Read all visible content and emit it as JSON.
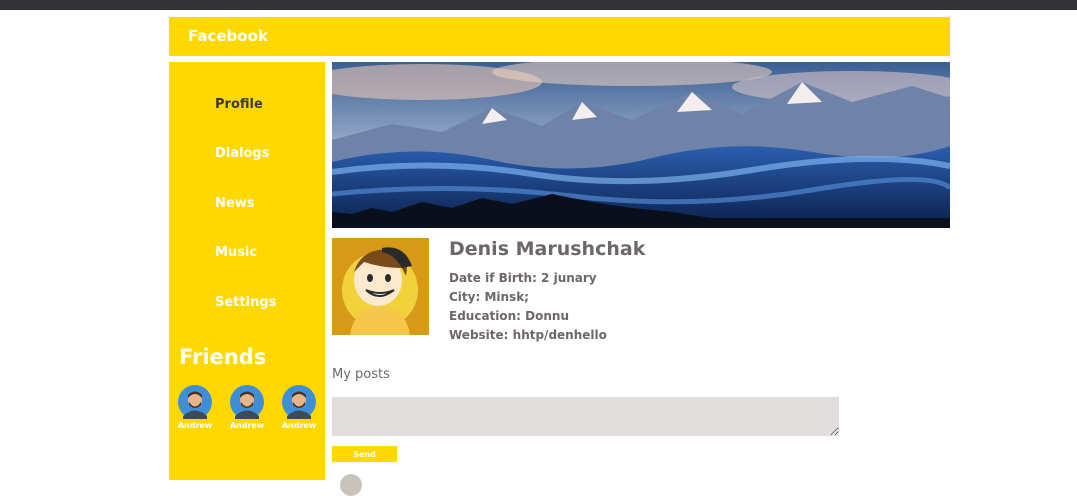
{
  "header": {
    "brand": "Facebook"
  },
  "sidebar": {
    "items": [
      {
        "label": "Profile",
        "active": true
      },
      {
        "label": "Dialogs",
        "active": false
      },
      {
        "label": "News",
        "active": false
      },
      {
        "label": "Music",
        "active": false
      },
      {
        "label": "Settings",
        "active": false
      }
    ],
    "friends_title": "Friends",
    "friends": [
      {
        "name": "Andrew"
      },
      {
        "name": "Andrew"
      },
      {
        "name": "Andrew"
      }
    ]
  },
  "profile": {
    "name": "Denis Marushchak",
    "birth": "Date if Birth: 2 junary",
    "city": "City: Minsk;",
    "education": "Education: Donnu",
    "website": "Website: hhtp/denhello"
  },
  "posts": {
    "title": "My posts",
    "input_value": "",
    "send_label": "Send"
  },
  "colors": {
    "accent": "#FFD800",
    "text": "#6d6767",
    "input_bg": "#e1dddd"
  }
}
